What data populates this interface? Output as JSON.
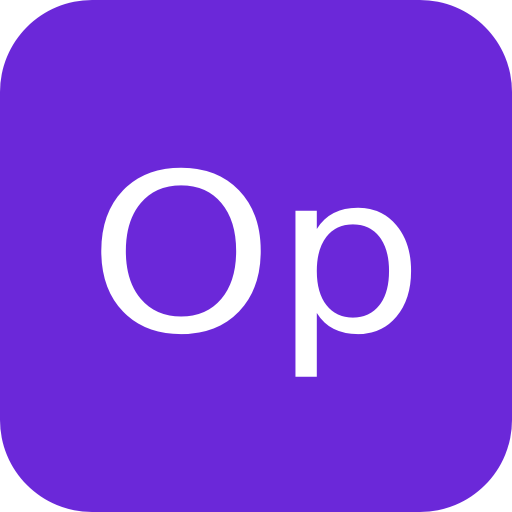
{
  "icon": {
    "monogram": "Op",
    "background_color": "#6b28d9",
    "text_color": "#ffffff"
  }
}
